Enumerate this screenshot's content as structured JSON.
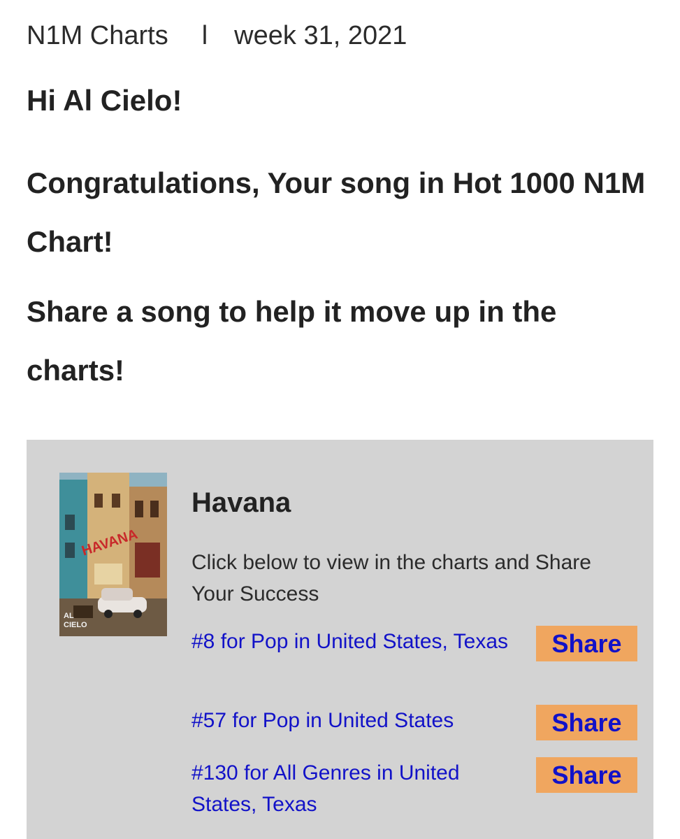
{
  "header": {
    "brand": "N1M Charts",
    "separator": "l",
    "week": "week 31, 2021"
  },
  "greeting": "Hi Al Cielo!",
  "congrats": "Congratulations, Your song in Hot 1000 N1M Chart!",
  "share_message": "Share a song to help it move up in the charts!",
  "song": {
    "title": "Havana",
    "cover_text": {
      "sign": "HAVANA",
      "artist_top": "AL",
      "artist_bottom": "CIELO"
    },
    "intro": "Click below to view in the charts and Share Your Success",
    "rankings": [
      {
        "text": "#8 for Pop in United States, Texas",
        "button": "Share"
      },
      {
        "text": "#57 for Pop in United States",
        "button": "Share"
      },
      {
        "text": "#130 for All Genres in United States, Texas",
        "button": "Share"
      }
    ]
  },
  "colors": {
    "panel_bg": "#d3d3d3",
    "link": "#1212c8",
    "share_button_bg": "#f0a65f"
  }
}
